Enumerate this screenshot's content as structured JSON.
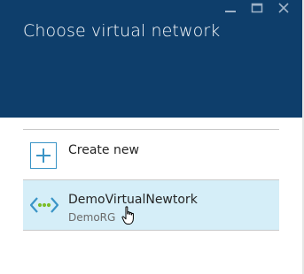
{
  "blade": {
    "title": "Choose virtual network"
  },
  "window_controls": [
    {
      "icon": "minimize-icon"
    },
    {
      "icon": "maximize-icon"
    },
    {
      "icon": "close-icon"
    }
  ],
  "list": {
    "create_new": {
      "icon": "plus-icon",
      "label": "Create new"
    },
    "networks": [
      {
        "icon": "virtual-network-icon",
        "name": "DemoVirtualNewtork",
        "resource_group": "DemoRG",
        "selected": true
      }
    ]
  },
  "colors": {
    "header_bg": "#0e3e6b",
    "selected_bg": "#d5eef8",
    "accent": "#3a94c6",
    "vnet_dots": "#7cbd2a"
  }
}
